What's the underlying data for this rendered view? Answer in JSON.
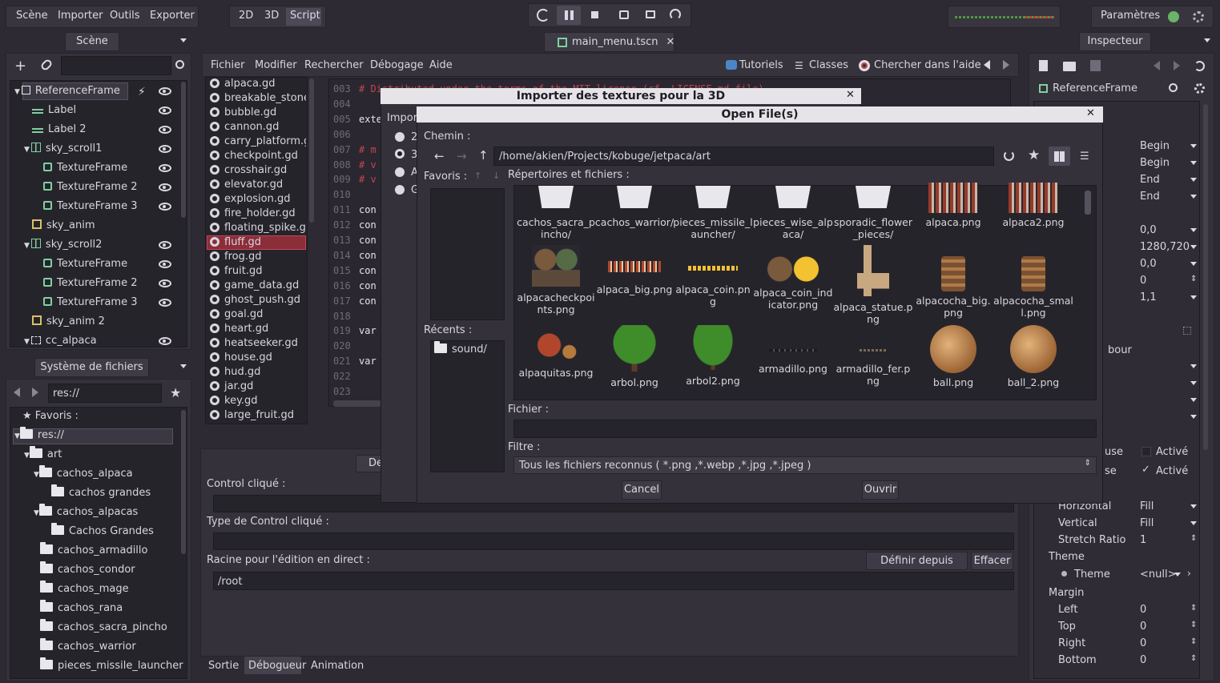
{
  "menubar": {
    "scene": "Scène",
    "import": "Importer",
    "tools": "Outils",
    "export": "Exporter"
  },
  "modes": {
    "d2": "2D",
    "d3": "3D",
    "script": "Script"
  },
  "settings": {
    "label": "Paramètres"
  },
  "scene_dock": {
    "title": "Scène"
  },
  "tab": {
    "label": "main_menu.tscn"
  },
  "inspector_dock": {
    "title": "Inspecteur",
    "node": "ReferenceFrame"
  },
  "scene_tree": [
    {
      "label": "ReferenceFrame"
    },
    {
      "label": "Label"
    },
    {
      "label": "Label 2"
    },
    {
      "label": "sky_scroll1"
    },
    {
      "label": "TextureFrame"
    },
    {
      "label": "TextureFrame 2"
    },
    {
      "label": "TextureFrame 3"
    },
    {
      "label": "sky_anim"
    },
    {
      "label": "sky_scroll2"
    },
    {
      "label": "TextureFrame"
    },
    {
      "label": "TextureFrame 2"
    },
    {
      "label": "TextureFrame 3"
    },
    {
      "label": "sky_anim 2"
    },
    {
      "label": "cc_alpaca"
    }
  ],
  "fs_dock": {
    "title": "Système de fichiers",
    "path": "res://",
    "favorites": "Favoris :",
    "root": "res://"
  },
  "fs_tree": [
    {
      "label": "art"
    },
    {
      "label": "cachos_alpaca"
    },
    {
      "label": "cachos grandes"
    },
    {
      "label": "cachos_alpacas"
    },
    {
      "label": "Cachos Grandes"
    },
    {
      "label": "cachos_armadillo"
    },
    {
      "label": "cachos_condor"
    },
    {
      "label": "cachos_mage"
    },
    {
      "label": "cachos_rana"
    },
    {
      "label": "cachos_sacra_pincho"
    },
    {
      "label": "cachos_warrior"
    },
    {
      "label": "pieces_missile_launcher"
    }
  ],
  "script_menu": {
    "file": "Fichier",
    "edit": "Modifier",
    "search": "Rechercher",
    "debug": "Débogage",
    "help": "Aide",
    "tutorials": "Tutoriels",
    "classes": "Classes",
    "search_help": "Chercher dans l'aide"
  },
  "script_files": [
    "alpaca.gd",
    "breakable_stone.gd",
    "bubble.gd",
    "cannon.gd",
    "carry_platform.gd",
    "checkpoint.gd",
    "crosshair.gd",
    "elevator.gd",
    "explosion.gd",
    "fire_holder.gd",
    "floating_spike.gd",
    "fluff.gd",
    "frog.gd",
    "fruit.gd",
    "game_data.gd",
    "ghost_push.gd",
    "goal.gd",
    "heart.gd",
    "heatseeker.gd",
    "house.gd",
    "hud.gd",
    "jar.gd",
    "key.gd",
    "large_fruit.gd"
  ],
  "code_lines": [
    {
      "n": "003",
      "t": "# Distributed under the terms of the MIT license (cf. LICENSE.md file)"
    },
    {
      "n": "004",
      "t": ""
    },
    {
      "n": "005",
      "t": "exte"
    },
    {
      "n": "006",
      "t": ""
    },
    {
      "n": "007",
      "t": "# m"
    },
    {
      "n": "008",
      "t": "# v"
    },
    {
      "n": "009",
      "t": "# v"
    },
    {
      "n": "010",
      "t": ""
    },
    {
      "n": "011",
      "t": "con"
    },
    {
      "n": "012",
      "t": "con"
    },
    {
      "n": "013",
      "t": "con"
    },
    {
      "n": "014",
      "t": "con"
    },
    {
      "n": "015",
      "t": "con"
    },
    {
      "n": "016",
      "t": "con"
    },
    {
      "n": "017",
      "t": "con"
    },
    {
      "n": "018",
      "t": ""
    },
    {
      "n": "019",
      "t": "var"
    },
    {
      "n": "020",
      "t": ""
    },
    {
      "n": "021",
      "t": "var"
    },
    {
      "n": "022",
      "t": ""
    },
    {
      "n": "023",
      "t": ""
    }
  ],
  "debugger": {
    "tab_partial": "De",
    "control_clicked": "Control cliqué :",
    "control_type": "Type de Control cliqué :",
    "live_edit_root": "Racine pour l'édition en direct :",
    "set_from_tree": "Définir depuis l'arbre",
    "clear": "Effacer",
    "root_value": "/root"
  },
  "bottom_tabs": {
    "output": "Sortie",
    "debugger": "Débogueur",
    "animation": "Animation"
  },
  "import_dialog": {
    "title": "Importer des textures pour la 3D",
    "import_label": "Import",
    "opt1": "2",
    "opt2": "3",
    "opt3": "A",
    "opt4": "G"
  },
  "file_dialog": {
    "title": "Open File(s)",
    "path_label": "Chemin :",
    "path": "/home/akien/Projects/kobuge/jetpaca/art",
    "favorites": "Favoris :",
    "dirs_files": "Répertoires et fichiers :",
    "recent": "Récents :",
    "recent_item": "sound/",
    "file_label": "Fichier :",
    "file_value": "",
    "filter_label": "Filtre :",
    "filter_value": "Tous les fichiers reconnus ( *.png ,*.webp ,*.jpg ,*.jpeg )",
    "cancel": "Cancel",
    "open": "Ouvrir"
  },
  "grid_items": [
    {
      "label": "cachos_sacra_pincho/",
      "kind": "folder"
    },
    {
      "label": "cachos_warrior/",
      "kind": "folder"
    },
    {
      "label": "pieces_missile_launcher/",
      "kind": "folder"
    },
    {
      "label": "pieces_wise_alpaca/",
      "kind": "folder"
    },
    {
      "label": "sporadic_flower_pieces/",
      "kind": "folder"
    },
    {
      "label": "alpaca.png",
      "kind": "sprites"
    },
    {
      "label": "alpaca2.png",
      "kind": "sprites"
    },
    {
      "label": "alpacacheckpoints.png",
      "kind": "statues"
    },
    {
      "label": "alpaca_big.png",
      "kind": "strip"
    },
    {
      "label": "alpaca_coin.png",
      "kind": "coinstrip"
    },
    {
      "label": "alpaca_coin_indicator.png",
      "kind": "coins"
    },
    {
      "label": "alpaca_statue.png",
      "kind": "statue"
    },
    {
      "label": "alpacocha_big.png",
      "kind": "totem"
    },
    {
      "label": "alpacocha_small.png",
      "kind": "totem"
    },
    {
      "label": "alpaquitas.png",
      "kind": "alpaquitas"
    },
    {
      "label": "arbol.png",
      "kind": "tree"
    },
    {
      "label": "arbol2.png",
      "kind": "tree2"
    },
    {
      "label": "armadillo.png",
      "kind": "line"
    },
    {
      "label": "armadillo_fer.png",
      "kind": "line2"
    },
    {
      "label": "ball.png",
      "kind": "ball"
    },
    {
      "label": "ball_2.png",
      "kind": "ball"
    }
  ],
  "inspector": {
    "rows_top": [
      {
        "v": "Begin"
      },
      {
        "v": "Begin"
      },
      {
        "v": "End"
      },
      {
        "v": "End"
      },
      {
        "v": "0,0"
      },
      {
        "v": "1280,720"
      },
      {
        "v": "0,0"
      },
      {
        "v": "0"
      },
      {
        "v": "1,1"
      }
    ],
    "partial_bour": "bour",
    "use_partial": "use",
    "se_partial": "se",
    "active1": "Activé",
    "active2": "Activé",
    "horizontal": "Horizontal",
    "horizontal_v": "Fill",
    "vertical": "Vertical",
    "vertical_v": "Fill",
    "stretch": "Stretch Ratio",
    "stretch_v": "1",
    "theme_section": "Theme",
    "theme": "Theme",
    "theme_v": "<null>",
    "margin_section": "Margin",
    "left": "Left",
    "left_v": "0",
    "top": "Top",
    "top_v": "0",
    "right": "Right",
    "right_v": "0",
    "bottom": "Bottom",
    "bottom_v": "0"
  }
}
